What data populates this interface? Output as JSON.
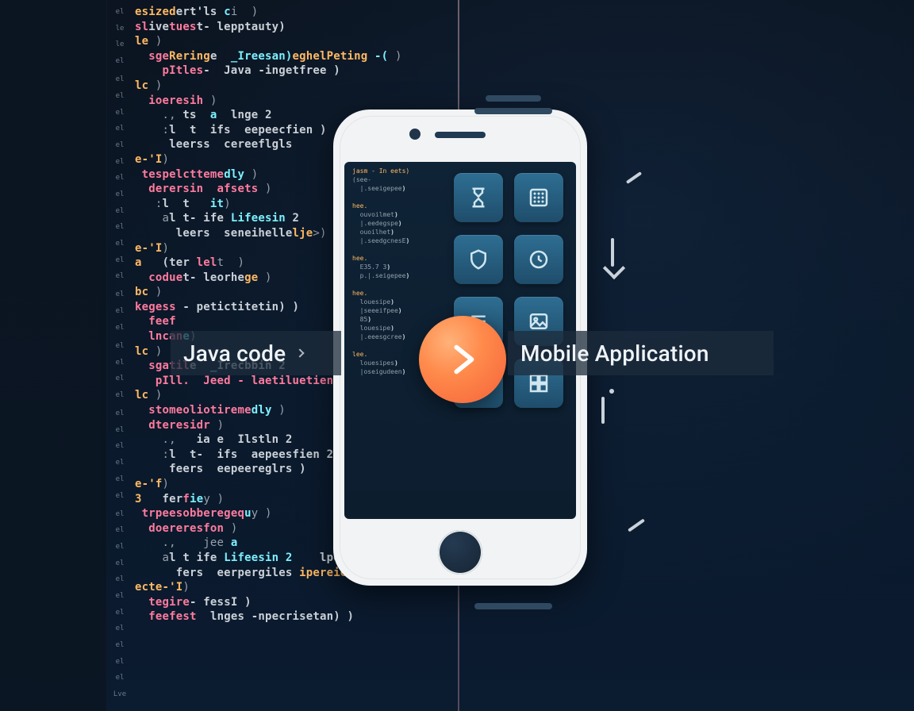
{
  "labels": {
    "left": "Java code",
    "right": "Mobile Application"
  },
  "lineNumbers": [
    "el",
    "le",
    "le",
    "el",
    "",
    "el",
    "el",
    "el",
    "el",
    "el",
    "el",
    "el",
    "el",
    "el",
    "el",
    "el",
    "el",
    "el",
    "",
    "el",
    "el",
    "el",
    "",
    "el",
    "el",
    "el",
    "el",
    "",
    "el",
    "el",
    "el",
    "el",
    "el",
    "el",
    "",
    "el",
    "el",
    "el",
    "el",
    "el",
    "el",
    "el",
    "el",
    "el",
    "el",
    "el",
    "Lve"
  ],
  "code": [
    {
      "seg": [
        {
          "c": "kw3",
          "t": "esized"
        },
        {
          "c": "kw2",
          "t": "ert'ls "
        },
        {
          "c": "kw1",
          "t": "c"
        },
        {
          "c": "dim",
          "t": "i  )"
        }
      ]
    },
    {
      "seg": [
        {
          "c": "kw4",
          "t": "sl"
        },
        {
          "c": "kw2",
          "t": "ive"
        },
        {
          "c": "kw4",
          "t": "tues"
        },
        {
          "c": "kw2",
          "t": "t- lepptauty)"
        }
      ]
    },
    {
      "seg": [
        {
          "c": "kw3",
          "t": "le "
        },
        {
          "c": "dim",
          "t": ")"
        }
      ]
    },
    {
      "seg": [
        {
          "c": "dim",
          "t": "  "
        },
        {
          "c": "kw4",
          "t": "sge"
        },
        {
          "c": "kw3",
          "t": "Rering"
        },
        {
          "c": "kw2",
          "t": "e  "
        },
        {
          "c": "kw1",
          "t": "_Ireesan)"
        },
        {
          "c": "kw3",
          "t": "eghelPeting "
        },
        {
          "c": "kw1",
          "t": "-("
        },
        {
          "c": "dim",
          "t": " )"
        }
      ]
    },
    {
      "seg": [
        {
          "c": "dim",
          "t": "    "
        },
        {
          "c": "kw4",
          "t": "pItles"
        },
        {
          "c": "kw2",
          "t": "-  Java -ingetfree )"
        }
      ]
    },
    {
      "seg": [
        {
          "c": "kw3",
          "t": "lc "
        },
        {
          "c": "dim",
          "t": ")"
        }
      ]
    },
    {
      "seg": [
        {
          "c": "dim",
          "t": "  "
        },
        {
          "c": "kw4",
          "t": "ioeresih "
        },
        {
          "c": "dim",
          "t": ")"
        }
      ]
    },
    {
      "seg": [
        {
          "c": "dim",
          "t": "    ., "
        },
        {
          "c": "kw2",
          "t": "ts  "
        },
        {
          "c": "kw1",
          "t": "a"
        },
        {
          "c": "kw2",
          "t": "  lnge 2"
        }
      ]
    },
    {
      "seg": [
        {
          "c": "dim",
          "t": "    :"
        },
        {
          "c": "kw2",
          "t": "l  t  ifs  eepeecfien )"
        }
      ]
    },
    {
      "seg": [
        {
          "c": "dim",
          "t": "     "
        },
        {
          "c": "kw2",
          "t": "leerss  cereeflgls"
        }
      ]
    },
    {
      "seg": [
        {
          "c": "kw3",
          "t": "e-'I"
        },
        {
          "c": "dim",
          "t": ")"
        }
      ]
    },
    {
      "seg": [
        {
          "c": "dim",
          "t": " "
        },
        {
          "c": "kw4",
          "t": "tespelctteme"
        },
        {
          "c": "kw1",
          "t": "dly"
        },
        {
          "c": "dim",
          "t": " )"
        }
      ]
    },
    {
      "seg": [
        {
          "c": "dim",
          "t": "  "
        },
        {
          "c": "kw4",
          "t": "derersin  afsets"
        },
        {
          "c": "dim",
          "t": " )"
        }
      ]
    },
    {
      "seg": [
        {
          "c": "dim",
          "t": "   :"
        },
        {
          "c": "kw2",
          "t": "l  t   "
        },
        {
          "c": "kw1",
          "t": "it"
        },
        {
          "c": "dim",
          "t": ")"
        }
      ]
    },
    {
      "seg": [
        {
          "c": "dim",
          "t": "    a"
        },
        {
          "c": "kw2",
          "t": "l t- ife "
        },
        {
          "c": "kw1",
          "t": "Lifeesin"
        },
        {
          "c": "kw2",
          "t": " 2"
        }
      ]
    },
    {
      "seg": [
        {
          "c": "dim",
          "t": "      "
        },
        {
          "c": "kw2",
          "t": "leers  seneihelle"
        },
        {
          "c": "kw3",
          "t": "lje"
        },
        {
          "c": "dim",
          "t": ">)"
        }
      ]
    },
    {
      "seg": [
        {
          "c": "kw3",
          "t": "e-'I"
        },
        {
          "c": "dim",
          "t": ")"
        }
      ]
    },
    {
      "seg": [
        {
          "c": "",
          "t": ""
        }
      ]
    },
    {
      "seg": [
        {
          "c": "kw3",
          "t": "a "
        },
        {
          "c": "kw2",
          "t": "  (ter "
        },
        {
          "c": "kw4",
          "t": "lel"
        },
        {
          "c": "dim",
          "t": "t  )"
        }
      ]
    },
    {
      "seg": [
        {
          "c": "dim",
          "t": "  "
        },
        {
          "c": "kw4",
          "t": "codue"
        },
        {
          "c": "kw2",
          "t": "t- leorhe"
        },
        {
          "c": "kw3",
          "t": "ge"
        },
        {
          "c": "dim",
          "t": " )"
        }
      ]
    },
    {
      "seg": [
        {
          "c": "",
          "t": ""
        }
      ]
    },
    {
      "seg": [
        {
          "c": "kw3",
          "t": "bc "
        },
        {
          "c": "dim",
          "t": ")"
        }
      ]
    },
    {
      "seg": [
        {
          "c": "kw4",
          "t": "kegess "
        },
        {
          "c": "kw2",
          "t": "- petictitetin) )"
        }
      ]
    },
    {
      "seg": [
        {
          "c": "dim",
          "t": "  "
        },
        {
          "c": "kw4",
          "t": "feef"
        }
      ]
    },
    {
      "seg": [
        {
          "c": "dim",
          "t": "  "
        },
        {
          "c": "kw4",
          "t": "lncan"
        },
        {
          "c": "kw1",
          "t": "e"
        },
        {
          "c": "dim",
          "t": ")"
        }
      ]
    },
    {
      "seg": [
        {
          "c": "",
          "t": ""
        }
      ]
    },
    {
      "seg": [
        {
          "c": "kw3",
          "t": "lc "
        },
        {
          "c": "dim",
          "t": ")"
        }
      ]
    },
    {
      "seg": [
        {
          "c": "dim",
          "t": "  "
        },
        {
          "c": "kw4",
          "t": "sgatil"
        },
        {
          "c": "kw2",
          "t": "e  "
        },
        {
          "c": "kw1",
          "t": "_"
        },
        {
          "c": "kw2",
          "t": "Irecbbin 2"
        }
      ]
    },
    {
      "seg": [
        {
          "c": "dim",
          "t": "   "
        },
        {
          "c": "kw4",
          "t": "pIll.  Jeed - laetiluetien"
        },
        {
          "c": "dim",
          "t": " )"
        }
      ]
    },
    {
      "seg": [
        {
          "c": "kw3",
          "t": "lc "
        },
        {
          "c": "dim",
          "t": ")"
        }
      ]
    },
    {
      "seg": [
        {
          "c": "dim",
          "t": "  "
        },
        {
          "c": "kw4",
          "t": "stomeoliotireme"
        },
        {
          "c": "kw1",
          "t": "dly"
        },
        {
          "c": "dim",
          "t": " )"
        }
      ]
    },
    {
      "seg": [
        {
          "c": "dim",
          "t": "  "
        },
        {
          "c": "kw4",
          "t": "dteresidr "
        },
        {
          "c": "dim",
          "t": ")"
        }
      ]
    },
    {
      "seg": [
        {
          "c": "dim",
          "t": "    .,   "
        },
        {
          "c": "kw2",
          "t": "ia e  Ilstln 2"
        }
      ]
    },
    {
      "seg": [
        {
          "c": "dim",
          "t": "    :"
        },
        {
          "c": "kw2",
          "t": "l  t-  ifs  aepeesfien 2"
        }
      ]
    },
    {
      "seg": [
        {
          "c": "dim",
          "t": "     "
        },
        {
          "c": "kw2",
          "t": "feers  eepeereglrs )"
        }
      ]
    },
    {
      "seg": [
        {
          "c": "kw3",
          "t": "e-'f"
        },
        {
          "c": "dim",
          "t": ")"
        }
      ]
    },
    {
      "seg": [
        {
          "c": "",
          "t": ""
        }
      ]
    },
    {
      "seg": [
        {
          "c": "kw3",
          "t": "3 "
        },
        {
          "c": "kw2",
          "t": "  fer"
        },
        {
          "c": "kw4",
          "t": "f"
        },
        {
          "c": "kw1",
          "t": "ie"
        },
        {
          "c": "dim",
          "t": "y )"
        }
      ]
    },
    {
      "seg": [
        {
          "c": "dim",
          "t": " "
        },
        {
          "c": "kw4",
          "t": "trpeesobberegeq"
        },
        {
          "c": "kw1",
          "t": "u"
        },
        {
          "c": "dim",
          "t": "y )"
        }
      ]
    },
    {
      "seg": [
        {
          "c": "dim",
          "t": "  "
        },
        {
          "c": "kw4",
          "t": "doereresfon "
        },
        {
          "c": "dim",
          "t": ")"
        }
      ]
    },
    {
      "seg": [
        {
          "c": "dim",
          "t": "    .,    jee "
        },
        {
          "c": "kw1",
          "t": "a"
        }
      ]
    },
    {
      "seg": [
        {
          "c": "dim",
          "t": "    a"
        },
        {
          "c": "kw2",
          "t": "l t ife "
        },
        {
          "c": "kw1",
          "t": "Lifeesin 2"
        },
        {
          "c": "dim",
          "t": "    "
        },
        {
          "c": "kw2",
          "t": "lperieenrepeesf )"
        }
      ]
    },
    {
      "seg": [
        {
          "c": "dim",
          "t": "      "
        },
        {
          "c": "kw2",
          "t": "fers  eerpergiles "
        },
        {
          "c": "kw3",
          "t": "ipereie"
        },
        {
          "c": "kw2",
          "t": "erpeesf )"
        }
      ]
    },
    {
      "seg": [
        {
          "c": "kw3",
          "t": "ecte-'I"
        },
        {
          "c": "dim",
          "t": ")"
        }
      ]
    },
    {
      "seg": [
        {
          "c": "",
          "t": ""
        }
      ]
    },
    {
      "seg": [
        {
          "c": "dim",
          "t": "  "
        },
        {
          "c": "kw4",
          "t": "tegire"
        },
        {
          "c": "kw2",
          "t": "- fessI )"
        }
      ]
    },
    {
      "seg": [
        {
          "c": "dim",
          "t": "  "
        },
        {
          "c": "kw4",
          "t": "feefest  "
        },
        {
          "c": "kw2",
          "t": "lnges -npecrisetan) )"
        }
      ]
    }
  ],
  "phoneCode": [
    "jasm - In eets)",
    "(see-",
    "  |.seeigepee)",
    "",
    "hee.",
    "  ouvoilmet)",
    "  |.eedegspe)",
    "  ouoilhet)",
    "  |.seedgcnesE)",
    "",
    "hee.",
    "  E35.7 3)",
    "  p.|.seigepee)",
    "",
    "hee.",
    "  louesipe)",
    "  |seeeifpee)",
    "  85)",
    "  louesipe)",
    "  |.eeesgcree)",
    "",
    "lee.",
    "  louesipes)",
    "  |oseigudeen)"
  ],
  "icons": [
    "hourglass",
    "keypad",
    "shield",
    "clock",
    "text",
    "photo",
    "speech",
    "grid"
  ]
}
